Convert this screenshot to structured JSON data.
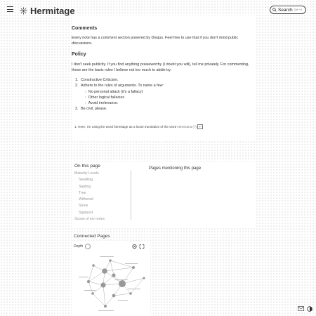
{
  "header": {
    "site_title": "Hermitage",
    "search_label": "Search",
    "search_shortcut": "Ctrl + K",
    "icons": [
      "menu-icon",
      "logo-icon",
      "search-icon"
    ]
  },
  "comments": {
    "heading": "Comments",
    "text": "Every note has a comment section powered by Disqus. Feel free to use that if you don't mind public discussions."
  },
  "policy": {
    "heading": "Policy",
    "text": "I don't seek publicity. If you find anything praiseworthy (I doubt you will), tell me privately. For commenting, these are the basic rules I believe not too much to abide by:",
    "rules": [
      "Constructive Criticism.",
      "Adhere to the rules of arguments. To name a few:",
      "Be civil, please."
    ],
    "sub_rules": [
      "No personal attack (it's a fallacy)",
      "Other logical fallacies",
      "Avoid irrelevance."
    ]
  },
  "footnote": {
    "number": "1.",
    "text": "Here, I'm using the word hermitage as a loose translation of the word",
    "link": "Newmana (?)",
    "backref": "↩"
  },
  "toc": {
    "title": "On this page",
    "items": [
      {
        "label": "Maturity Levels",
        "level": 1
      },
      {
        "label": "Seedling",
        "level": 2
      },
      {
        "label": "Sapling",
        "level": 2
      },
      {
        "label": "Tree",
        "level": 2
      },
      {
        "label": "Withered",
        "level": 2
      },
      {
        "label": "Stone",
        "level": 2
      },
      {
        "label": "Signpost",
        "level": 2
      },
      {
        "label": "Scope of my notes",
        "level": 1
      }
    ]
  },
  "pages_mentioning": {
    "title": "Pages mentioning this page"
  },
  "connected": {
    "title": "Connected Pages",
    "depth_label": "Depth",
    "icons": [
      "settings-icon",
      "fullscreen-icon"
    ]
  },
  "bottom_icons": [
    "mail-icon",
    "theme-toggle-icon"
  ]
}
